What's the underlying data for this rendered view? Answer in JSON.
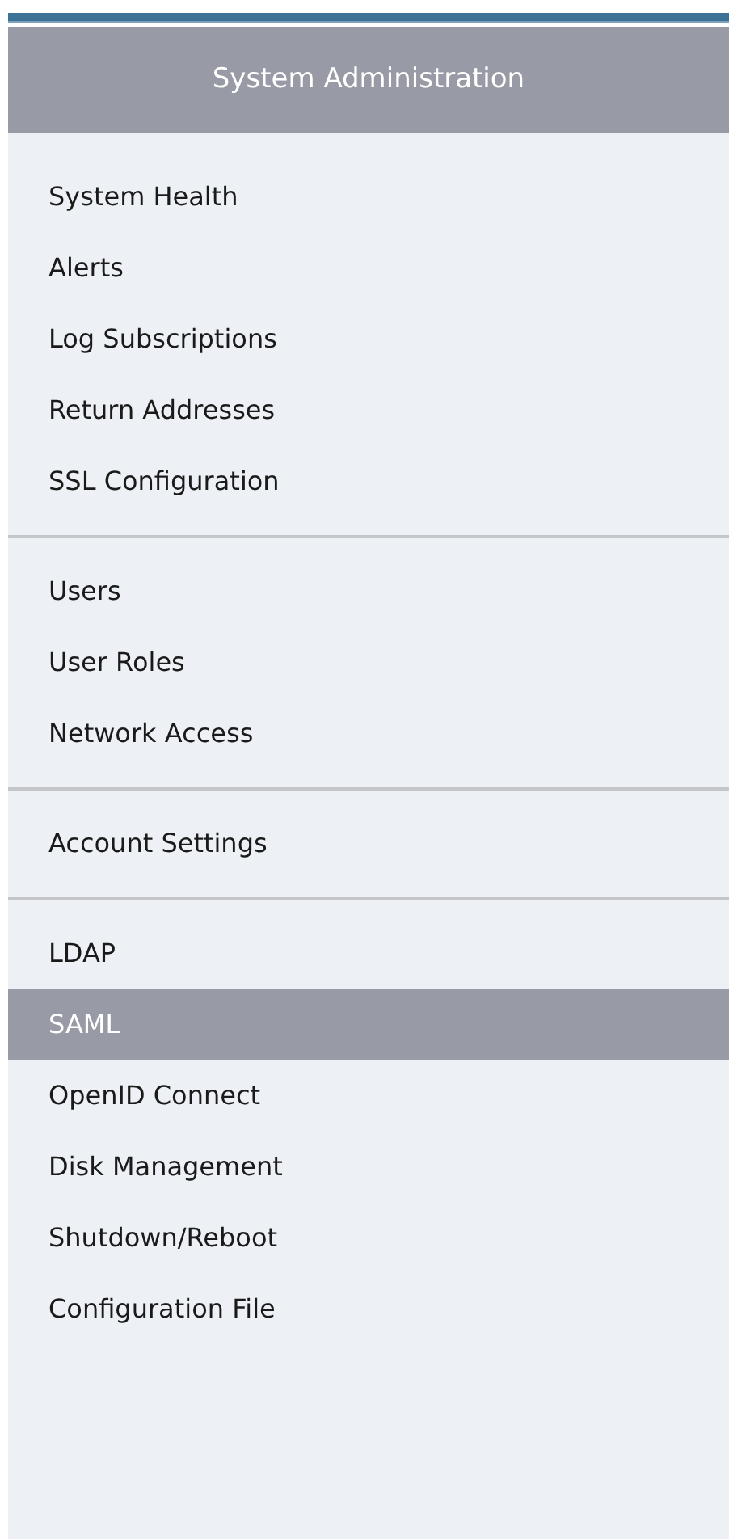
{
  "menu": {
    "title": "System Administration",
    "groups": [
      {
        "items": [
          {
            "label": "System Health",
            "selected": false
          },
          {
            "label": "Alerts",
            "selected": false
          },
          {
            "label": "Log Subscriptions",
            "selected": false
          },
          {
            "label": "Return Addresses",
            "selected": false
          },
          {
            "label": "SSL Configuration",
            "selected": false
          }
        ]
      },
      {
        "items": [
          {
            "label": "Users",
            "selected": false
          },
          {
            "label": "User Roles",
            "selected": false
          },
          {
            "label": "Network Access",
            "selected": false
          }
        ]
      },
      {
        "items": [
          {
            "label": "Account Settings",
            "selected": false
          }
        ]
      },
      {
        "items": [
          {
            "label": "LDAP",
            "selected": false
          },
          {
            "label": "SAML",
            "selected": true
          },
          {
            "label": "OpenID Connect",
            "selected": false
          },
          {
            "label": "Disk Management",
            "selected": false
          },
          {
            "label": "Shutdown/Reboot",
            "selected": false
          },
          {
            "label": "Configuration File",
            "selected": false
          }
        ]
      }
    ]
  }
}
